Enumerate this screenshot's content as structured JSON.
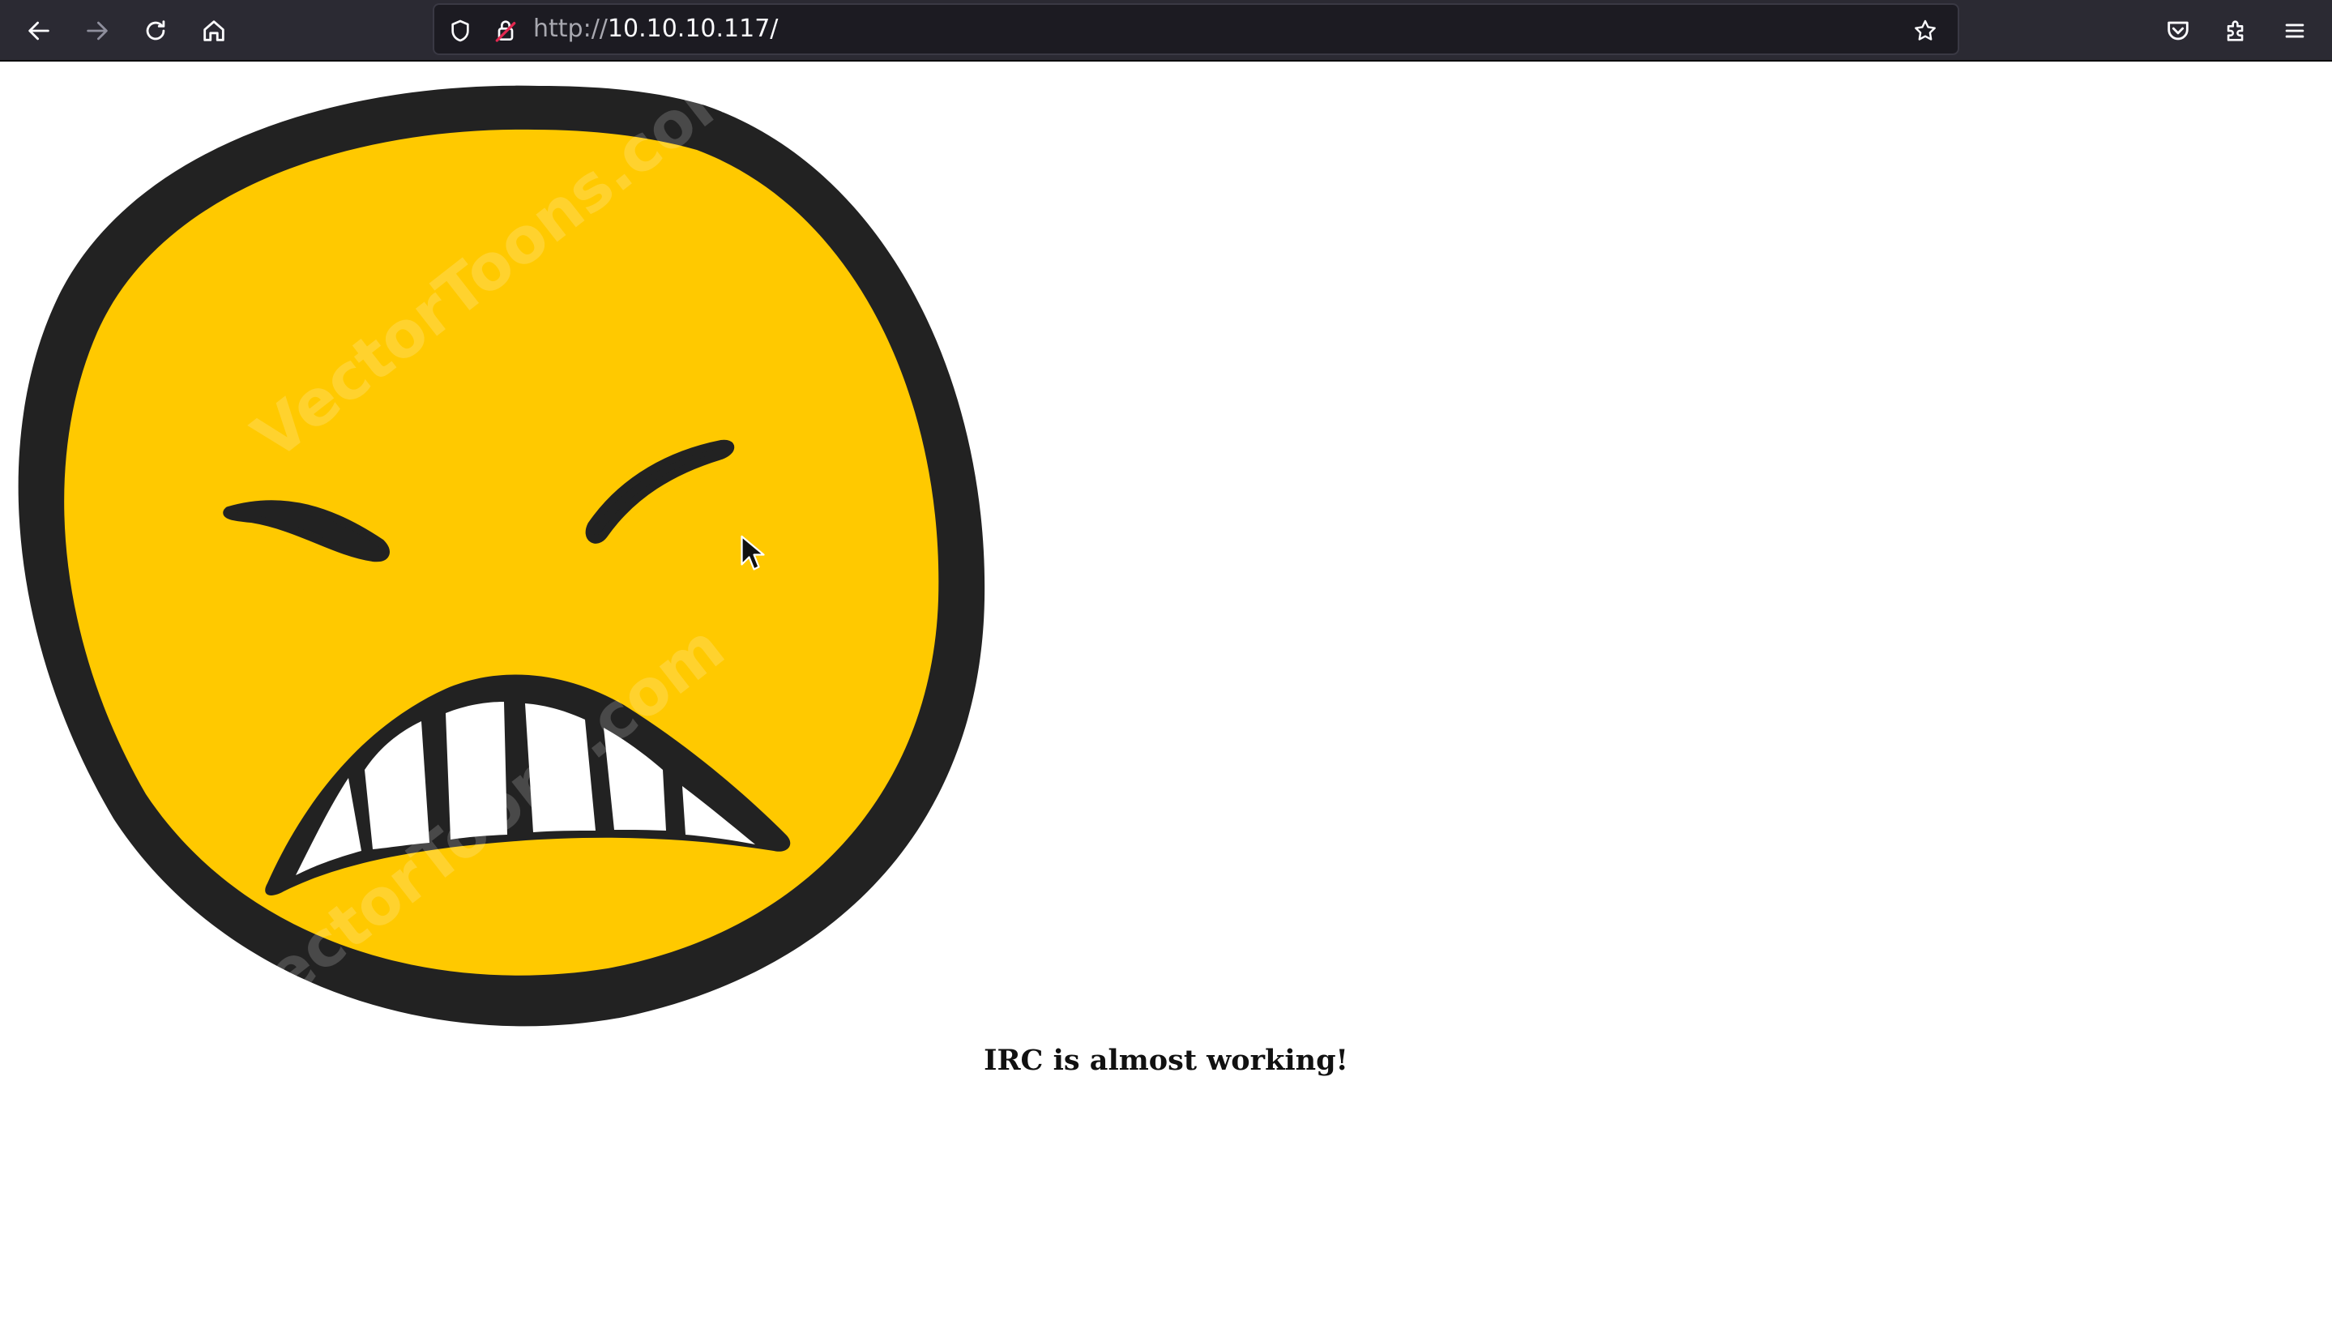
{
  "browser": {
    "url_scheme": "http://",
    "url_host": "10.10.10.117/",
    "icons": {
      "back": "back-arrow-icon",
      "forward": "forward-arrow-icon",
      "reload": "reload-icon",
      "home": "home-icon",
      "shield": "tracking-protection-shield-icon",
      "lock": "insecure-lock-icon",
      "bookmark": "bookmark-star-icon",
      "pocket": "pocket-icon",
      "extensions": "extensions-puzzle-icon",
      "menu": "hamburger-menu-icon"
    },
    "colors": {
      "toolbar_bg": "#2b2a33",
      "urlbar_bg": "#1c1b22",
      "icon": "#fbfbfe",
      "insecure_lock": "#e22850"
    }
  },
  "page": {
    "caption": "IRC is almost working!",
    "image": {
      "description_icon": "angry-face-icon",
      "face_color": "#ffc900",
      "outline_color": "#222222",
      "watermark": "VectorToons.com"
    }
  }
}
